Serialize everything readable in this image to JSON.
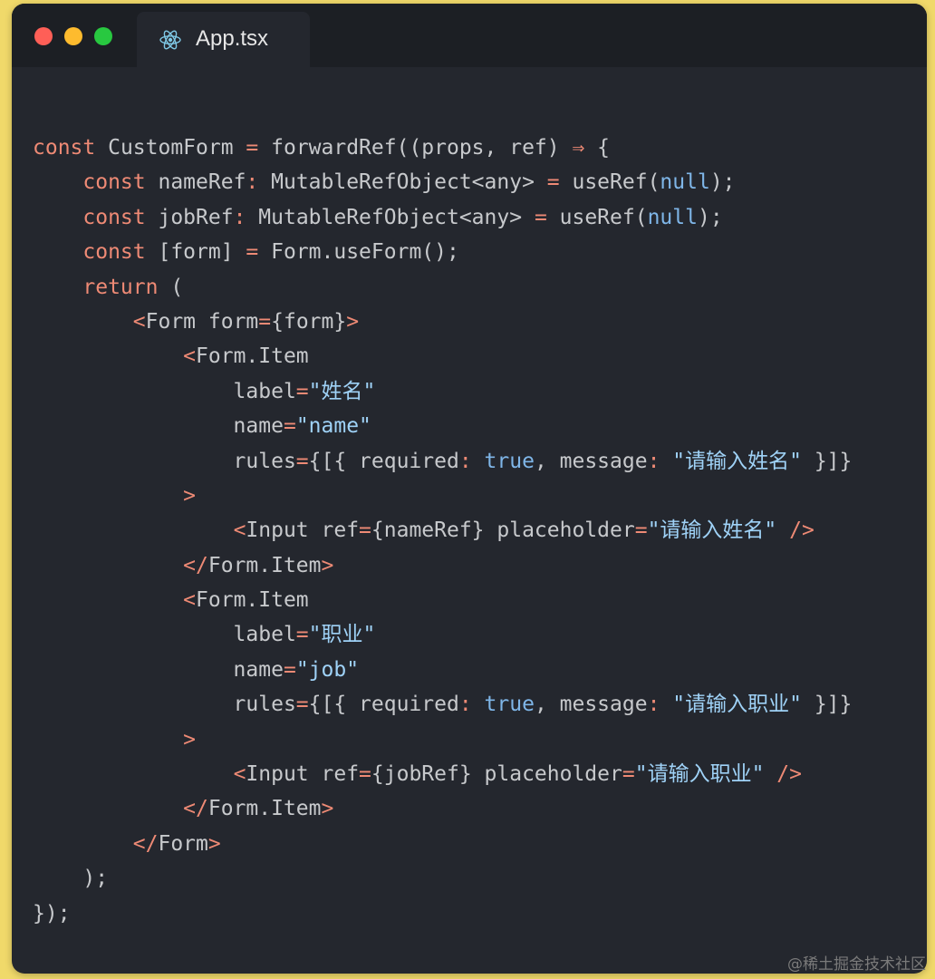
{
  "window": {
    "traffic_lights": [
      "close",
      "minimize",
      "zoom"
    ],
    "tab": {
      "title": "App.tsx",
      "icon": "react-icon"
    }
  },
  "code": {
    "lines": [
      [
        {
          "t": "kw",
          "v": "const"
        },
        {
          "t": "plain",
          "v": " CustomForm "
        },
        {
          "t": "op",
          "v": "="
        },
        {
          "t": "plain",
          "v": " forwardRef((props, ref) "
        },
        {
          "t": "op",
          "v": "⇒"
        },
        {
          "t": "plain",
          "v": " {"
        }
      ],
      [
        {
          "t": "plain",
          "v": "    "
        },
        {
          "t": "kw",
          "v": "const"
        },
        {
          "t": "plain",
          "v": " nameRef"
        },
        {
          "t": "op",
          "v": ":"
        },
        {
          "t": "plain",
          "v": " MutableRefObject<any> "
        },
        {
          "t": "op",
          "v": "="
        },
        {
          "t": "plain",
          "v": " useRef("
        },
        {
          "t": "lit",
          "v": "null"
        },
        {
          "t": "plain",
          "v": ");"
        }
      ],
      [
        {
          "t": "plain",
          "v": "    "
        },
        {
          "t": "kw",
          "v": "const"
        },
        {
          "t": "plain",
          "v": " jobRef"
        },
        {
          "t": "op",
          "v": ":"
        },
        {
          "t": "plain",
          "v": " MutableRefObject<any> "
        },
        {
          "t": "op",
          "v": "="
        },
        {
          "t": "plain",
          "v": " useRef("
        },
        {
          "t": "lit",
          "v": "null"
        },
        {
          "t": "plain",
          "v": ");"
        }
      ],
      [
        {
          "t": "plain",
          "v": "    "
        },
        {
          "t": "kw",
          "v": "const"
        },
        {
          "t": "plain",
          "v": " [form] "
        },
        {
          "t": "op",
          "v": "="
        },
        {
          "t": "plain",
          "v": " Form.useForm();"
        }
      ],
      [
        {
          "t": "plain",
          "v": "    "
        },
        {
          "t": "kw",
          "v": "return"
        },
        {
          "t": "plain",
          "v": " ("
        }
      ],
      [
        {
          "t": "plain",
          "v": "        "
        },
        {
          "t": "tag",
          "v": "<"
        },
        {
          "t": "plain",
          "v": "Form form"
        },
        {
          "t": "op",
          "v": "="
        },
        {
          "t": "plain",
          "v": "{form}"
        },
        {
          "t": "tag",
          "v": ">"
        }
      ],
      [
        {
          "t": "plain",
          "v": "            "
        },
        {
          "t": "tag",
          "v": "<"
        },
        {
          "t": "plain",
          "v": "Form.Item"
        }
      ],
      [
        {
          "t": "plain",
          "v": "                label"
        },
        {
          "t": "op",
          "v": "="
        },
        {
          "t": "str",
          "v": "\"姓名\""
        }
      ],
      [
        {
          "t": "plain",
          "v": "                name"
        },
        {
          "t": "op",
          "v": "="
        },
        {
          "t": "str",
          "v": "\"name\""
        }
      ],
      [
        {
          "t": "plain",
          "v": "                rules"
        },
        {
          "t": "op",
          "v": "="
        },
        {
          "t": "plain",
          "v": "{[{ required"
        },
        {
          "t": "op",
          "v": ":"
        },
        {
          "t": "plain",
          "v": " "
        },
        {
          "t": "lit",
          "v": "true"
        },
        {
          "t": "plain",
          "v": ", message"
        },
        {
          "t": "op",
          "v": ":"
        },
        {
          "t": "plain",
          "v": " "
        },
        {
          "t": "str",
          "v": "\"请输入姓名\""
        },
        {
          "t": "plain",
          "v": " }]}"
        }
      ],
      [
        {
          "t": "plain",
          "v": "            "
        },
        {
          "t": "tag",
          "v": ">"
        }
      ],
      [
        {
          "t": "plain",
          "v": "                "
        },
        {
          "t": "tag",
          "v": "<"
        },
        {
          "t": "plain",
          "v": "Input ref"
        },
        {
          "t": "op",
          "v": "="
        },
        {
          "t": "plain",
          "v": "{nameRef} placeholder"
        },
        {
          "t": "op",
          "v": "="
        },
        {
          "t": "str",
          "v": "\"请输入姓名\""
        },
        {
          "t": "plain",
          "v": " "
        },
        {
          "t": "tag",
          "v": "/>"
        }
      ],
      [
        {
          "t": "plain",
          "v": "            "
        },
        {
          "t": "tag",
          "v": "</"
        },
        {
          "t": "plain",
          "v": "Form.Item"
        },
        {
          "t": "tag",
          "v": ">"
        }
      ],
      [
        {
          "t": "plain",
          "v": "            "
        },
        {
          "t": "tag",
          "v": "<"
        },
        {
          "t": "plain",
          "v": "Form.Item"
        }
      ],
      [
        {
          "t": "plain",
          "v": "                label"
        },
        {
          "t": "op",
          "v": "="
        },
        {
          "t": "str",
          "v": "\"职业\""
        }
      ],
      [
        {
          "t": "plain",
          "v": "                name"
        },
        {
          "t": "op",
          "v": "="
        },
        {
          "t": "str",
          "v": "\"job\""
        }
      ],
      [
        {
          "t": "plain",
          "v": "                rules"
        },
        {
          "t": "op",
          "v": "="
        },
        {
          "t": "plain",
          "v": "{[{ required"
        },
        {
          "t": "op",
          "v": ":"
        },
        {
          "t": "plain",
          "v": " "
        },
        {
          "t": "lit",
          "v": "true"
        },
        {
          "t": "plain",
          "v": ", message"
        },
        {
          "t": "op",
          "v": ":"
        },
        {
          "t": "plain",
          "v": " "
        },
        {
          "t": "str",
          "v": "\"请输入职业\""
        },
        {
          "t": "plain",
          "v": " }]}"
        }
      ],
      [
        {
          "t": "plain",
          "v": "            "
        },
        {
          "t": "tag",
          "v": ">"
        }
      ],
      [
        {
          "t": "plain",
          "v": "                "
        },
        {
          "t": "tag",
          "v": "<"
        },
        {
          "t": "plain",
          "v": "Input ref"
        },
        {
          "t": "op",
          "v": "="
        },
        {
          "t": "plain",
          "v": "{jobRef} placeholder"
        },
        {
          "t": "op",
          "v": "="
        },
        {
          "t": "str",
          "v": "\"请输入职业\""
        },
        {
          "t": "plain",
          "v": " "
        },
        {
          "t": "tag",
          "v": "/>"
        }
      ],
      [
        {
          "t": "plain",
          "v": "            "
        },
        {
          "t": "tag",
          "v": "</"
        },
        {
          "t": "plain",
          "v": "Form.Item"
        },
        {
          "t": "tag",
          "v": ">"
        }
      ],
      [
        {
          "t": "plain",
          "v": "        "
        },
        {
          "t": "tag",
          "v": "</"
        },
        {
          "t": "plain",
          "v": "Form"
        },
        {
          "t": "tag",
          "v": ">"
        }
      ],
      [
        {
          "t": "plain",
          "v": "    );"
        }
      ],
      [
        {
          "t": "plain",
          "v": "});"
        }
      ]
    ]
  },
  "watermark": "@稀土掘金技术社区",
  "colors": {
    "page_background": "#f0d96a",
    "editor_background": "#24272e",
    "keyword": "#ee8a75",
    "string": "#9fd2f7",
    "literal": "#7fb6e8",
    "text": "#c7c9cc"
  }
}
